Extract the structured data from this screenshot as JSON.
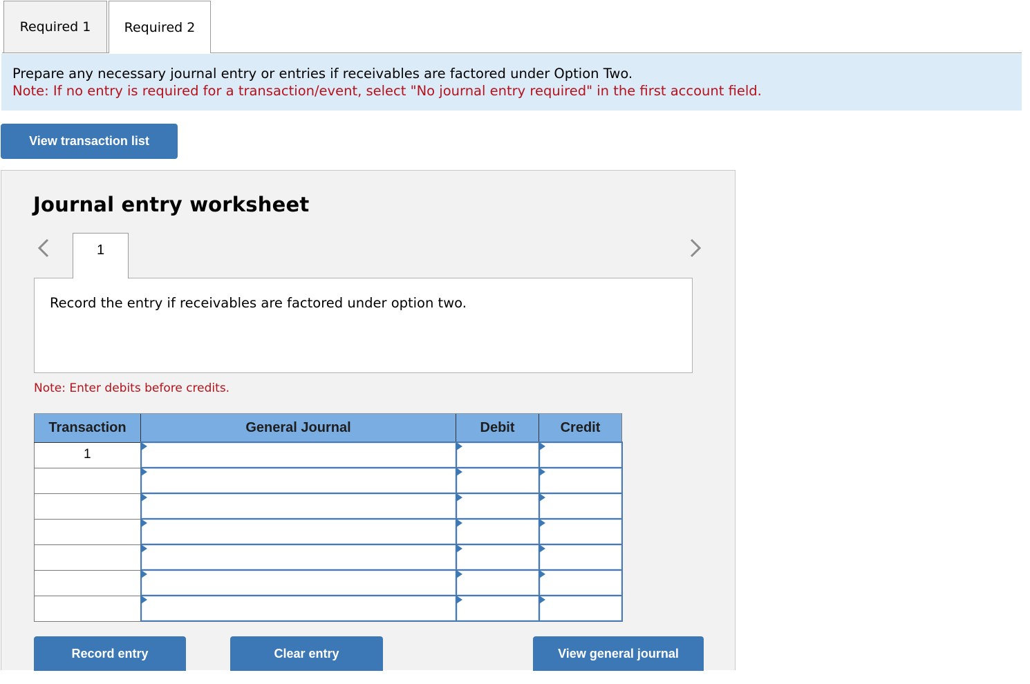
{
  "tabs": [
    {
      "label": "Required 1",
      "active": false
    },
    {
      "label": "Required 2",
      "active": true
    }
  ],
  "instructions": {
    "main": "Prepare any necessary journal entry or entries if receivables are factored under Option Two.",
    "note": "Note: If no entry is required for a transaction/event, select \"No journal entry required\" in the first account field."
  },
  "buttons": {
    "view_transaction_list": "View transaction list",
    "record_entry": "Record entry",
    "clear_entry": "Clear entry",
    "view_general_journal": "View general journal"
  },
  "worksheet": {
    "title": "Journal entry worksheet",
    "steps": [
      "1"
    ],
    "current_step": "1",
    "description": "Record the entry if receivables are factored under option two.",
    "note": "Note: Enter debits before credits.",
    "table": {
      "headers": [
        "Transaction",
        "General Journal",
        "Debit",
        "Credit"
      ],
      "rows": [
        {
          "transaction": "1",
          "account": "",
          "debit": "",
          "credit": ""
        },
        {
          "transaction": "",
          "account": "",
          "debit": "",
          "credit": ""
        },
        {
          "transaction": "",
          "account": "",
          "debit": "",
          "credit": ""
        },
        {
          "transaction": "",
          "account": "",
          "debit": "",
          "credit": ""
        },
        {
          "transaction": "",
          "account": "",
          "debit": "",
          "credit": ""
        },
        {
          "transaction": "",
          "account": "",
          "debit": "",
          "credit": ""
        },
        {
          "transaction": "",
          "account": "",
          "debit": "",
          "credit": ""
        }
      ]
    }
  },
  "icons": {
    "prev": "chevron-left-icon",
    "next": "chevron-right-icon",
    "cell_marker": "triangle-marker-icon"
  },
  "colors": {
    "accent_button": "#3c78b5",
    "header_blue": "#7aaee2",
    "instruction_bg": "#dcebf8",
    "note_red": "#b5121b",
    "worksheet_bg": "#f2f2f2"
  }
}
